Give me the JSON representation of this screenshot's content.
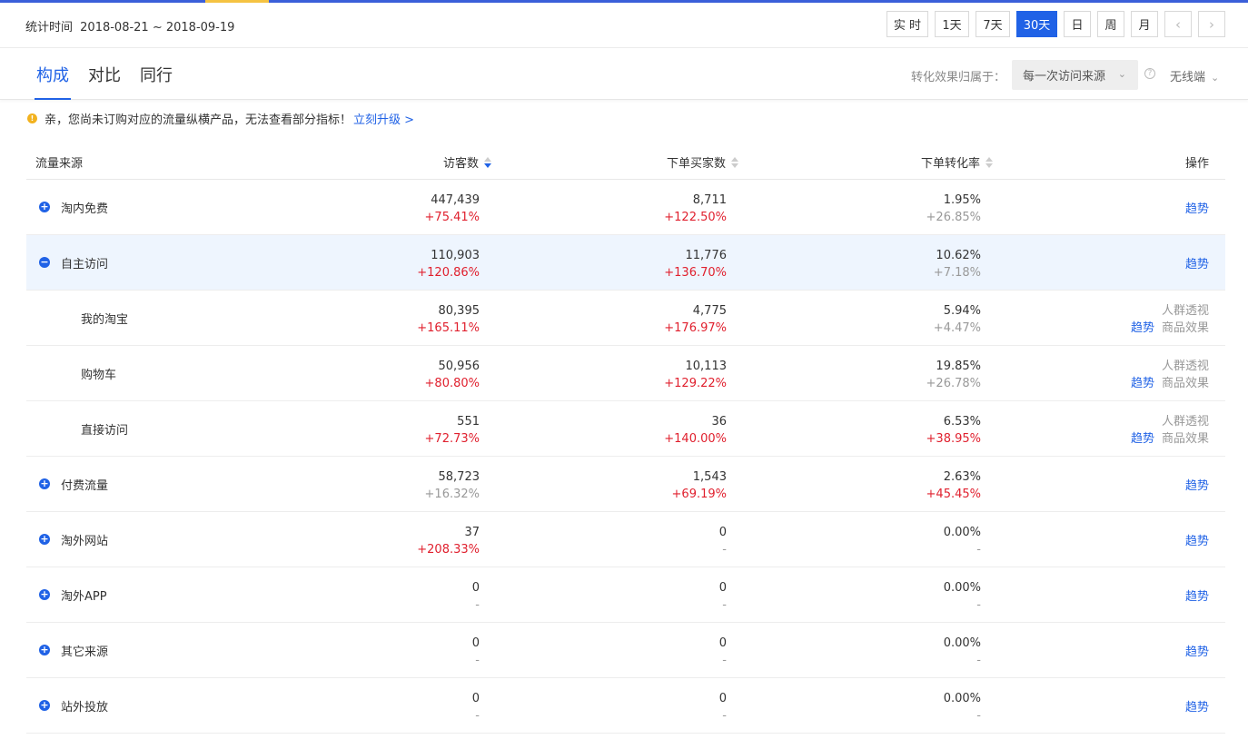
{
  "header": {
    "period_label": "统计时间",
    "period_value": "2018-08-21 ~ 2018-09-19",
    "range_buttons": [
      "实 时",
      "1天",
      "7天",
      "30天",
      "日",
      "周",
      "月"
    ],
    "active_range": "30天",
    "prev_icon": "chevron-left-icon",
    "next_icon": "chevron-right-icon"
  },
  "tabs": [
    {
      "label": "构成",
      "active": true
    },
    {
      "label": "对比",
      "active": false
    },
    {
      "label": "同行",
      "active": false
    }
  ],
  "attribution": {
    "label": "转化效果归属于：",
    "selected": "每一次访问来源",
    "help_icon": "question-circle-icon",
    "device": "无线端"
  },
  "notice": {
    "icon": "warning-icon",
    "text": "亲，您尚未订购对应的流量纵横产品，无法查看部分指标！",
    "link": "立刻升级 >"
  },
  "table": {
    "columns": [
      "流量来源",
      "访客数",
      "下单买家数",
      "下单转化率",
      "操作"
    ],
    "rows": [
      {
        "name": "淘内免费",
        "level": 0,
        "expanded": false,
        "visitors": "447,439",
        "visitors_delta": "+75.41%",
        "visitors_up": true,
        "buyers": "8,711",
        "buyers_delta": "+122.50%",
        "buyers_up": true,
        "rate": "1.95%",
        "rate_delta": "+26.85%",
        "rate_up": false,
        "action": "趋势"
      },
      {
        "name": "自主访问",
        "level": 0,
        "expanded": true,
        "visitors": "110,903",
        "visitors_delta": "+120.86%",
        "visitors_up": true,
        "buyers": "11,776",
        "buyers_delta": "+136.70%",
        "buyers_up": true,
        "rate": "10.62%",
        "rate_delta": "+7.18%",
        "rate_up": false,
        "action": "趋势"
      },
      {
        "name": "我的淘宝",
        "level": 1,
        "visitors": "80,395",
        "visitors_delta": "+165.11%",
        "visitors_up": true,
        "buyers": "4,775",
        "buyers_delta": "+176.97%",
        "buyers_up": true,
        "rate": "5.94%",
        "rate_delta": "+4.47%",
        "rate_up": false,
        "action": "趋势",
        "action2": "人群透视",
        "action3": "商品效果"
      },
      {
        "name": "购物车",
        "level": 1,
        "visitors": "50,956",
        "visitors_delta": "+80.80%",
        "visitors_up": true,
        "buyers": "10,113",
        "buyers_delta": "+129.22%",
        "buyers_up": true,
        "rate": "19.85%",
        "rate_delta": "+26.78%",
        "rate_up": false,
        "action": "趋势",
        "action2": "人群透视",
        "action3": "商品效果"
      },
      {
        "name": "直接访问",
        "level": 1,
        "visitors": "551",
        "visitors_delta": "+72.73%",
        "visitors_up": true,
        "buyers": "36",
        "buyers_delta": "+140.00%",
        "buyers_up": true,
        "rate": "6.53%",
        "rate_delta": "+38.95%",
        "rate_up": true,
        "action": "趋势",
        "action2": "人群透视",
        "action3": "商品效果"
      },
      {
        "name": "付费流量",
        "level": 0,
        "expanded": false,
        "visitors": "58,723",
        "visitors_delta": "+16.32%",
        "visitors_up": false,
        "buyers": "1,543",
        "buyers_delta": "+69.19%",
        "buyers_up": true,
        "rate": "2.63%",
        "rate_delta": "+45.45%",
        "rate_up": true,
        "action": "趋势"
      },
      {
        "name": "淘外网站",
        "level": 0,
        "expanded": false,
        "visitors": "37",
        "visitors_delta": "+208.33%",
        "visitors_up": true,
        "buyers": "0",
        "buyers_delta": "-",
        "buyers_up": false,
        "rate": "0.00%",
        "rate_delta": "-",
        "rate_up": false,
        "action": "趋势"
      },
      {
        "name": "淘外APP",
        "level": 0,
        "expanded": false,
        "visitors": "0",
        "visitors_delta": "-",
        "visitors_up": false,
        "buyers": "0",
        "buyers_delta": "-",
        "buyers_up": false,
        "rate": "0.00%",
        "rate_delta": "-",
        "rate_up": false,
        "action": "趋势"
      },
      {
        "name": "其它来源",
        "level": 0,
        "expanded": false,
        "visitors": "0",
        "visitors_delta": "-",
        "visitors_up": false,
        "buyers": "0",
        "buyers_delta": "-",
        "buyers_up": false,
        "rate": "0.00%",
        "rate_delta": "-",
        "rate_up": false,
        "action": "趋势"
      },
      {
        "name": "站外投放",
        "level": 0,
        "expanded": false,
        "visitors": "0",
        "visitors_delta": "-",
        "visitors_up": false,
        "buyers": "0",
        "buyers_delta": "-",
        "buyers_up": false,
        "rate": "0.00%",
        "rate_delta": "-",
        "rate_up": false,
        "action": "趋势"
      }
    ]
  },
  "colors": {
    "accent": "#2062e6",
    "increase": "#e0202e",
    "muted": "#999999",
    "highlight_row": "#eef5fe"
  }
}
